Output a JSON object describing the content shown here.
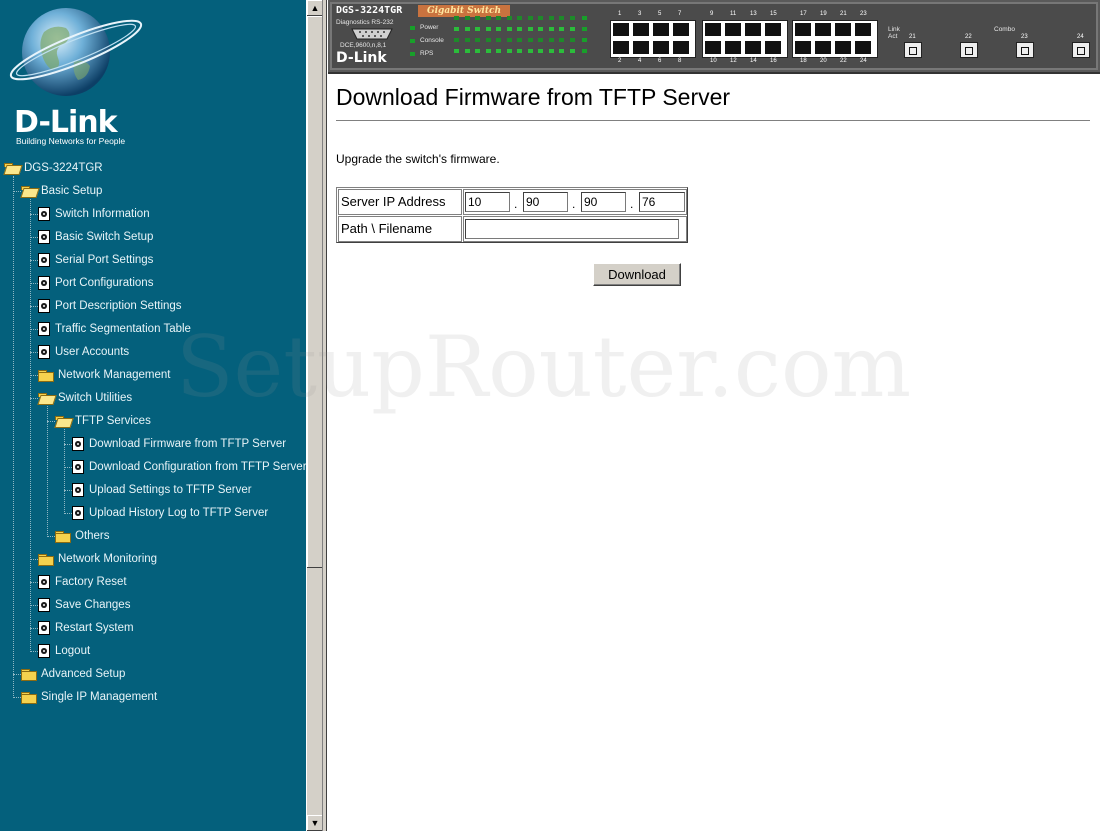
{
  "brand": {
    "logo": "D-Link",
    "tagline": "Building Networks for People"
  },
  "device_panel": {
    "model": "DGS-3224TGR",
    "series": "Gigabit Switch",
    "labels": {
      "diagnostics": "Diagnostics RS-232",
      "serial": "DCE,9600,n,8,1",
      "power": "Power",
      "console": "Console",
      "rps": "RPS",
      "logo": "D-Link",
      "combo": "Combo",
      "link": "Link",
      "act": "Act"
    },
    "top_numbers": [
      "1",
      "3",
      "5",
      "7",
      "9",
      "11",
      "13",
      "15",
      "17",
      "19",
      "21",
      "23"
    ],
    "bottom_numbers": [
      "2",
      "4",
      "6",
      "8",
      "10",
      "12",
      "14",
      "16",
      "18",
      "20",
      "22",
      "24"
    ],
    "sfp_numbers": [
      "21",
      "22",
      "23",
      "24"
    ],
    "colors": {
      "led": "#18a02a",
      "accent": "#c9733f"
    }
  },
  "nav": {
    "root": "DGS-3224TGR",
    "items": [
      {
        "label": "Basic Setup",
        "icon": "folder-open-icon"
      },
      {
        "label": "Switch Information",
        "icon": "document-icon"
      },
      {
        "label": "Basic Switch Setup",
        "icon": "document-icon"
      },
      {
        "label": "Serial Port Settings",
        "icon": "document-icon"
      },
      {
        "label": "Port Configurations",
        "icon": "document-icon"
      },
      {
        "label": "Port Description Settings",
        "icon": "document-icon"
      },
      {
        "label": "Traffic Segmentation Table",
        "icon": "document-icon"
      },
      {
        "label": "User Accounts",
        "icon": "document-icon"
      },
      {
        "label": "Network Management",
        "icon": "folder-icon"
      },
      {
        "label": "Switch Utilities",
        "icon": "folder-open-icon"
      },
      {
        "label": "TFTP Services",
        "icon": "folder-open-icon"
      },
      {
        "label": "Download Firmware from TFTP Server",
        "icon": "document-icon"
      },
      {
        "label": "Download Configuration from TFTP Server",
        "icon": "document-icon"
      },
      {
        "label": "Upload Settings to TFTP Server",
        "icon": "document-icon"
      },
      {
        "label": "Upload History Log to TFTP Server",
        "icon": "document-icon"
      },
      {
        "label": "Others",
        "icon": "folder-icon"
      },
      {
        "label": "Network Monitoring",
        "icon": "folder-icon"
      },
      {
        "label": "Factory Reset",
        "icon": "document-icon"
      },
      {
        "label": "Save Changes",
        "icon": "document-icon"
      },
      {
        "label": "Restart System",
        "icon": "document-icon"
      },
      {
        "label": "Logout",
        "icon": "document-icon"
      },
      {
        "label": "Advanced Setup",
        "icon": "folder-icon"
      },
      {
        "label": "Single IP Management",
        "icon": "folder-icon"
      }
    ],
    "colors": {
      "background": "#04607c",
      "text": "#e8f4f8"
    }
  },
  "page": {
    "title": "Download Firmware from TFTP Server",
    "description": "Upgrade the switch's firmware.",
    "form": {
      "server_ip_label": "Server IP Address",
      "ip_octets": [
        "10",
        "90",
        "90",
        "76"
      ],
      "ip_separator": ".",
      "path_label": "Path \\ Filename",
      "path_value": ""
    },
    "download_button": "Download"
  },
  "watermark": "SetupRouter.com"
}
